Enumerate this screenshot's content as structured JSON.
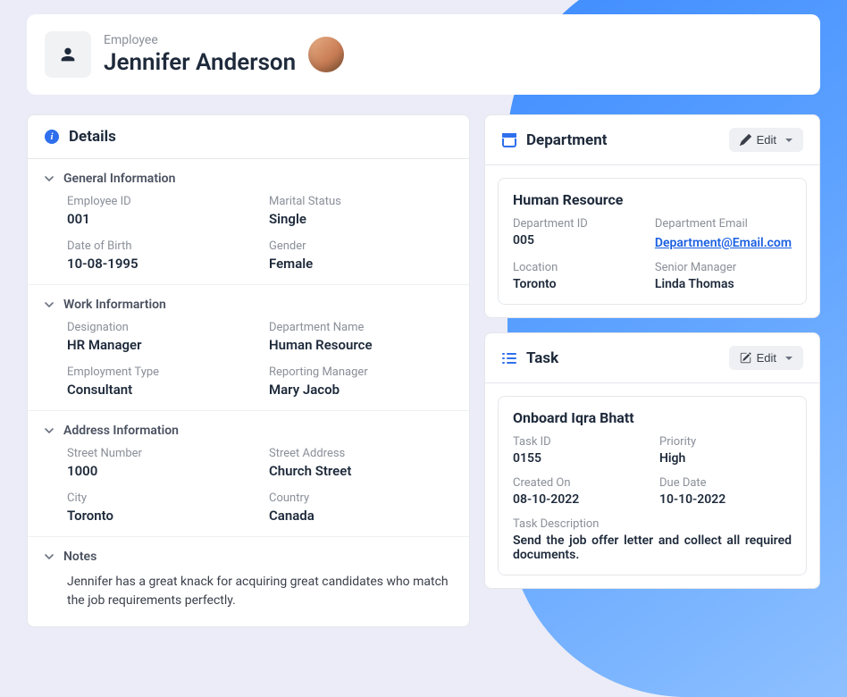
{
  "header": {
    "subtitle": "Employee",
    "title": "Jennifer Anderson"
  },
  "details": {
    "title": "Details",
    "sections": {
      "general": {
        "title": "General Information",
        "employee_id_label": "Employee ID",
        "employee_id": "001",
        "marital_status_label": "Marital Status",
        "marital_status": "Single",
        "dob_label": "Date of Birth",
        "dob": "10-08-1995",
        "gender_label": "Gender",
        "gender": "Female"
      },
      "work": {
        "title": "Work Informartion",
        "designation_label": "Designation",
        "designation": "HR Manager",
        "department_name_label": "Department Name",
        "department_name": "Human Resource",
        "employment_type_label": "Employment Type",
        "employment_type": "Consultant",
        "reporting_manager_label": "Reporting Manager",
        "reporting_manager": "Mary Jacob"
      },
      "address": {
        "title": "Address Information",
        "street_number_label": "Street Number",
        "street_number": "1000",
        "street_address_label": "Street Address",
        "street_address": "Church Street",
        "city_label": "City",
        "city": "Toronto",
        "country_label": "Country",
        "country": "Canada"
      },
      "notes": {
        "title": "Notes",
        "body": "Jennifer has a great knack for acquiring great candidates who match the job requirements perfectly."
      }
    }
  },
  "department": {
    "header_title": "Department",
    "edit_label": "Edit",
    "name": "Human Resource",
    "dept_id_label": "Department ID",
    "dept_id": "005",
    "dept_email_label": "Department Email",
    "dept_email": "Department@Email.com",
    "location_label": "Location",
    "location": "Toronto",
    "senior_manager_label": "Senior  Manager",
    "senior_manager": "Linda Thomas"
  },
  "task": {
    "header_title": "Task",
    "edit_label": "Edit",
    "name": "Onboard Iqra Bhatt",
    "task_id_label": "Task ID",
    "task_id": "0155",
    "priority_label": "Priority",
    "priority": "High",
    "created_on_label": "Created On",
    "created_on": "08-10-2022",
    "due_date_label": "Due Date",
    "due_date": "10-10-2022",
    "description_label": "Task Description",
    "description": "Send the job offer letter and collect all required documents."
  }
}
